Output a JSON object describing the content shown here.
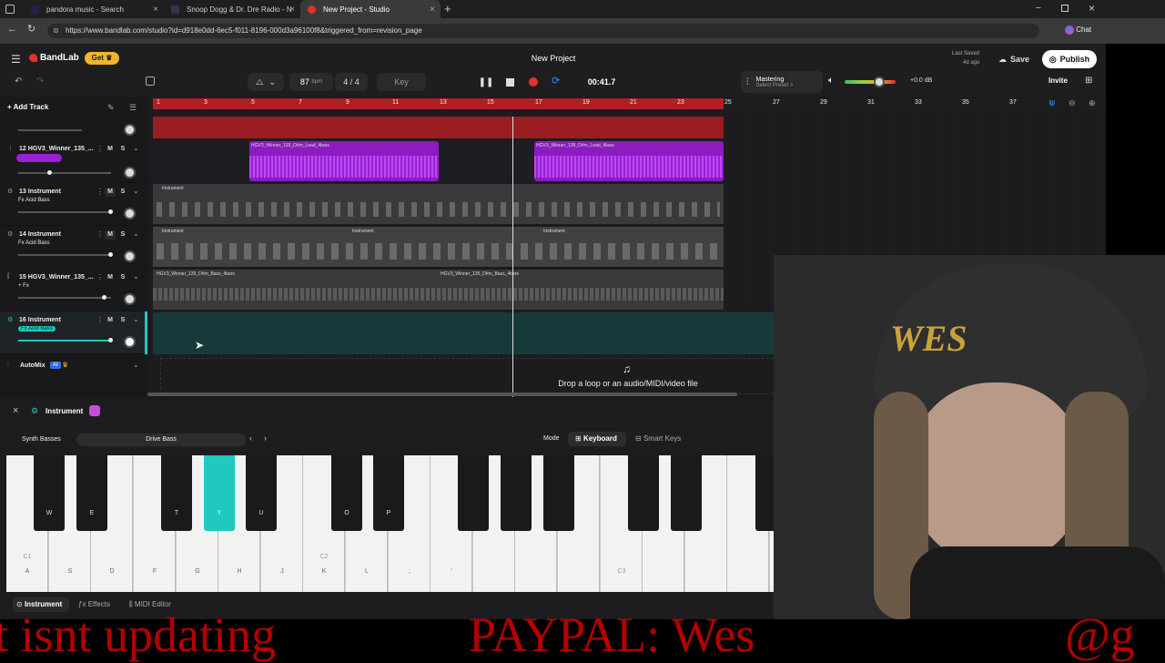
{
  "browser": {
    "tabs": [
      {
        "label": "pandora music - Search"
      },
      {
        "label": "Snoop Dogg & Dr. Dre Radio - N"
      },
      {
        "label": "New Project - Studio"
      }
    ],
    "url": "https://www.bandlab.com/studio?id=d918e0dd-6ec5-f011-8196-000d3a96100f8&triggered_from=revision_page",
    "chat_label": "Chat"
  },
  "header": {
    "logo": "BandLab",
    "get_label": "Get",
    "title": "New Project",
    "last_saved": "Last Saved",
    "last_saved_ago": "4d ago",
    "save_label": "Save",
    "publish_label": "Publish",
    "invite_label": "Invite"
  },
  "transport": {
    "bpm": "87",
    "bpm_unit": "bpm",
    "time_sig": "4 / 4",
    "key_label": "Key",
    "time": "00:41.7",
    "mastering": "Mastering",
    "select_preset": "Select Preset >",
    "db": "+0.0 dB"
  },
  "sidebar": {
    "add_track": "Add Track",
    "tracks": [
      {
        "num": "12",
        "name": "HGV3_Winner_135_...",
        "sub": ""
      },
      {
        "num": "13",
        "name": "Instrument",
        "sub": "Fx Acid Bass"
      },
      {
        "num": "14",
        "name": "Instrument",
        "sub": "Fx Acid Bass"
      },
      {
        "num": "15",
        "name": "HGV3_Winner_135_...",
        "sub": "+ Fx"
      },
      {
        "num": "16",
        "name": "Instrument",
        "sub": "Fx Acid Bass"
      }
    ],
    "m": "M",
    "s": "S",
    "automix": "AutoMix",
    "ai": "AI"
  },
  "ruler": [
    "1",
    "3",
    "5",
    "7",
    "9",
    "11",
    "13",
    "15",
    "17",
    "19",
    "21",
    "23",
    "25",
    "27",
    "29",
    "31",
    "33",
    "35",
    "37"
  ],
  "clips": {
    "lead_a": "HGV3_Winner_135_D#m_Lead_4bars",
    "lead_b": "HGV3_Winner_135_D#m_Lead_4bars",
    "bass_a": "HGV3_Winner_135_D#m_Bass_4bars",
    "bass_b": "HGV3_Winner_135_D#m_Bass_4bars",
    "inst": "Instrument"
  },
  "drop": "Drop a loop or an audio/MIDI/video file",
  "panel": {
    "title": "Instrument",
    "category": "Synth Basses",
    "preset": "Drive Bass",
    "mode": "Mode",
    "keyboard": "Keyboard",
    "smart_keys": "Smart Keys",
    "tabs": [
      "Instrument",
      "Effects",
      "MIDI Editor"
    ]
  },
  "keys": {
    "white": [
      "A",
      "S",
      "D",
      "F",
      "G",
      "H",
      "J",
      "K",
      "L",
      ";",
      "'",
      "",
      "",
      "",
      "",
      "",
      "",
      "",
      "",
      ""
    ],
    "black": [
      "W",
      "E",
      "T",
      "Y",
      "U",
      "O",
      "P",
      "",
      "",
      "",
      "",
      "",
      "",
      ""
    ],
    "octaves": [
      "C1",
      "C2",
      "C3"
    ]
  },
  "webcam": {
    "hat_text": "WES"
  },
  "overlay": {
    "left": "t isnt updating",
    "right": "PAYPAL: Wes",
    "tail": "@g"
  },
  "colors": {
    "accent": "#e0322c",
    "clip_purple": "#9b1fd6",
    "teal": "#1fc9c0",
    "rec": "#e0322c"
  }
}
